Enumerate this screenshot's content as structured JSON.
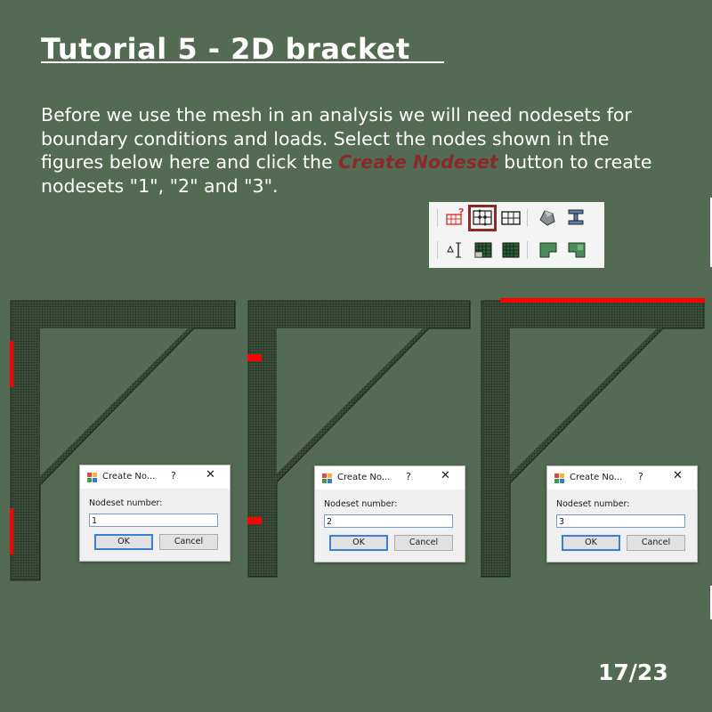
{
  "slide": {
    "title": "Tutorial 5 - 2D bracket",
    "body_before": "Before we use the mesh in an analysis we will need nodesets for boundary conditions and loads. Select the nodes shown in the figures below here and click the ",
    "body_highlight": "Create Nodeset",
    "body_after": " button to create nodesets \"1\", \"2\" and \"3\".",
    "highlight_color": "#8b2a2a",
    "background_color": "#536b52",
    "page_number": "17/23"
  },
  "toolbar": {
    "row1_icons": [
      "mesh-question-icon",
      "create-nodeset-icon",
      "element-grid-icon",
      "solid-shape-icon",
      "i-beam-icon"
    ],
    "row2_icons": [
      "dimension-icon",
      "dense-mesh-icon",
      "fine-mesh-icon",
      "region-left-icon",
      "region-right-icon"
    ],
    "highlighted_icon": "create-nodeset-icon"
  },
  "selection_color": "#ff0000",
  "mesh_color": "#2b3a2b",
  "dialogs": [
    {
      "title": "Create No...",
      "help": "?",
      "close": "✕",
      "label": "Nodeset number:",
      "value": "1",
      "ok": "OK",
      "cancel": "Cancel"
    },
    {
      "title": "Create No...",
      "help": "?",
      "close": "✕",
      "label": "Nodeset number:",
      "value": "2",
      "ok": "OK",
      "cancel": "Cancel"
    },
    {
      "title": "Create No...",
      "help": "?",
      "close": "✕",
      "label": "Nodeset number:",
      "value": "3",
      "ok": "OK",
      "cancel": "Cancel"
    }
  ]
}
